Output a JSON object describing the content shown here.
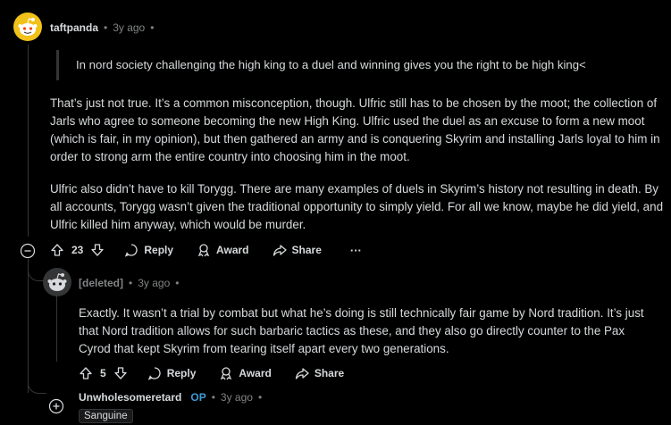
{
  "comment1": {
    "username": "taftpanda",
    "age": "3y ago",
    "quote": "In nord society challenging the high king to a duel and winning gives you the right to be high king<",
    "paragraphs": [
      "That’s just not true. It’s a common misconception, though. Ulfric still has to be chosen by the moot; the collection of Jarls who agree to someone becoming the new High King. Ulfric used the duel as an excuse to form a new moot (which is fair, in my opinion), but then gathered an army and is conquering Skyrim and installing Jarls loyal to him in order to strong arm the entire country into choosing him in the moot.",
      "Ulfric also didn’t have to kill Torygg. There are many examples of duels in Skyrim’s history not resulting in death. By all accounts, Torygg wasn’t given the traditional opportunity to simply yield. For all we know, maybe he did yield, and Ulfric killed him anyway, which would be murder."
    ],
    "votes": "23",
    "reply_label": "Reply",
    "award_label": "Award",
    "share_label": "Share",
    "more_label": "···"
  },
  "comment2": {
    "username": "[deleted]",
    "age": "3y ago",
    "paragraph": "Exactly. It wasn’t a trial by combat but what he’s doing is still technically fair game by Nord tradition. It’s just that Nord tradition allows for such barbaric tactics as these, and they also go directly counter to the Pax Cyrod that kept Skyrim from tearing itself apart every two generations.",
    "votes": "5",
    "reply_label": "Reply",
    "award_label": "Award",
    "share_label": "Share"
  },
  "comment3": {
    "username": "Unwholesomeretard",
    "op_badge": "OP",
    "age": "3y ago",
    "flair": "Sanguine"
  },
  "colors": {
    "background": "#000000",
    "text": "#d7dadc",
    "muted": "#818384",
    "op": "#3f9bd6",
    "avatar_yellow": "#f2c21b"
  },
  "icons": [
    "snoo-avatar-icon",
    "collapse-icon",
    "upvote-icon",
    "downvote-icon",
    "reply-icon",
    "award-icon",
    "share-icon",
    "more-icon",
    "expand-icon"
  ]
}
